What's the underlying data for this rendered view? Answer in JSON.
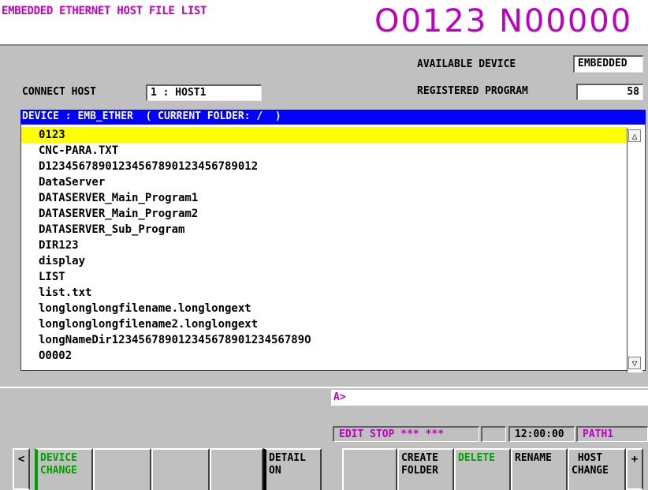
{
  "header": {
    "screen_title": "EMBEDDED ETHERNET HOST FILE LIST",
    "program_number": "O0123 N00000"
  },
  "info": {
    "available_device_label": "AVAILABLE DEVICE",
    "available_device_value": "EMBEDDED",
    "connect_host_label": "CONNECT HOST",
    "connect_host_value": "1 : HOST1",
    "registered_program_label": "REGISTERED PROGRAM",
    "registered_program_value": "58"
  },
  "list": {
    "device_bar": "DEVICE : EMB_ETHER  ( CURRENT FOLDER: /  )",
    "items": [
      "0123",
      "CNC-PARA.TXT",
      "D12345678901234567890123456789012",
      "DataServer",
      "DATASERVER_Main_Program1",
      "DATASERVER_Main_Program2",
      "DATASERVER_Sub_Program",
      "DIR123",
      "display",
      "LIST",
      "list.txt",
      "longlonglongfilename.longlongext",
      "longlonglongfilename2.longlongext",
      "longNameDir12345678901234567890123456789O",
      "O0002"
    ],
    "selected_index": 0,
    "scroll_up": "△",
    "scroll_down": "▽"
  },
  "input": {
    "prompt": "A>"
  },
  "status": {
    "mode": "EDIT STOP *** ***",
    "blank": "",
    "time": "12:00:00",
    "path": "PATH1"
  },
  "softkeys": {
    "prev": "<",
    "device_change": "DEVICE\nCHANGE",
    "blank1": "",
    "blank2": "",
    "blank3": "",
    "blank4": "",
    "detail_on": "DETAIL\nON",
    "blank5": "",
    "create_folder": "CREATE\nFOLDER",
    "delete": "DELETE",
    "rename": "RENAME",
    "host_change": " HOST\nCHANGE",
    "next": "+"
  },
  "colors": {
    "title_magenta": "#c000c0",
    "panel_gray": "#c0c0c0",
    "device_bar_blue": "#0000ff",
    "selection_yellow": "#ffff00",
    "softkey_green": "#00a000"
  }
}
